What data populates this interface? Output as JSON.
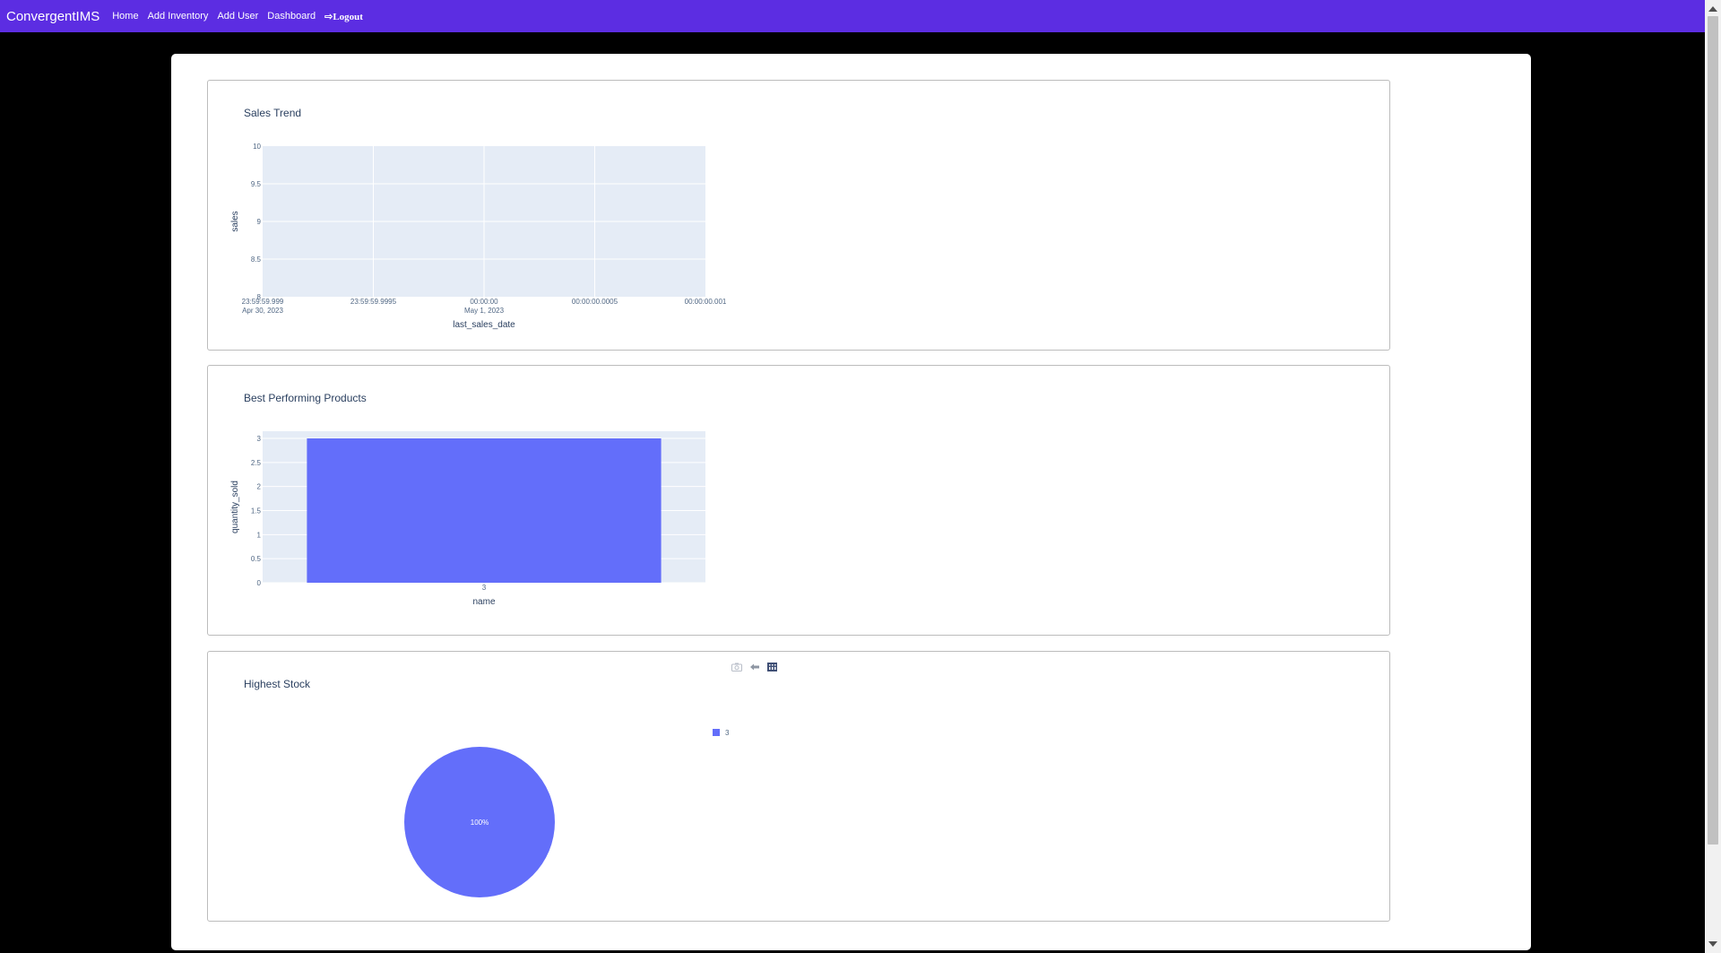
{
  "navbar": {
    "brand": "ConvergentIMS",
    "links": [
      "Home",
      "Add Inventory",
      "Add User",
      "Dashboard"
    ],
    "logout": "⇨Logout"
  },
  "colors": {
    "navbar": "#5c2de2",
    "plot_bg": "#e5ecf6",
    "series": "#636efa",
    "title": "#2a3f5f"
  },
  "charts": {
    "sales_trend": {
      "title": "Sales Trend"
    },
    "best_products": {
      "title": "Best Performing Products"
    },
    "highest_stock": {
      "title": "Highest Stock"
    }
  },
  "modebar_icons": [
    "camera-icon",
    "autoscale-icon",
    "plotly-logo-icon"
  ],
  "chart_data": [
    {
      "type": "line",
      "title": "Sales Trend",
      "xlabel": "last_sales_date",
      "ylabel": "sales",
      "x_tick_labels": [
        "23:59:59.999\nApr 30, 2023",
        "23:59:59.9995",
        "00:00:00\nMay 1, 2023",
        "00:00:00.0005",
        "00:00:00.001"
      ],
      "y_ticks": [
        "8",
        "8.5",
        "9",
        "9.5",
        "10"
      ],
      "ylim": [
        8,
        10
      ],
      "series": [
        {
          "values": []
        }
      ],
      "grid": true
    },
    {
      "type": "bar",
      "title": "Best Performing Products",
      "xlabel": "name",
      "ylabel": "quantity_sold",
      "categories": [
        "3"
      ],
      "values": [
        3
      ],
      "y_ticks": [
        "0",
        "0.5",
        "1",
        "1.5",
        "2",
        "2.5",
        "3"
      ],
      "ylim": [
        0,
        3
      ],
      "grid": true
    },
    {
      "type": "pie",
      "title": "Highest Stock",
      "labels": [
        "3"
      ],
      "values": [
        100
      ],
      "slice_label": "100%",
      "legend": [
        "3"
      ],
      "legend_position": "top-right"
    }
  ]
}
